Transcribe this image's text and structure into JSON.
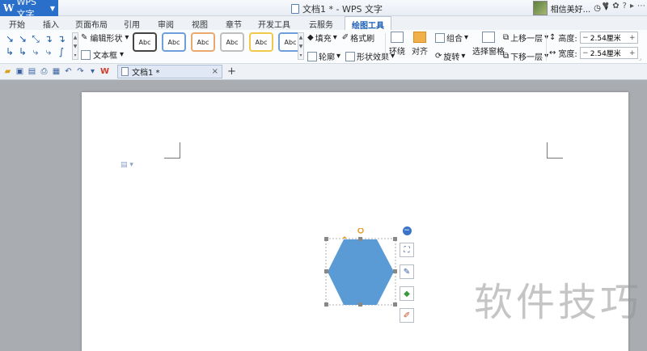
{
  "titlebar": {
    "app_name": "WPS 文字",
    "window_title": "文档1 * - WPS 文字",
    "user_name": "相信美好..."
  },
  "tabs": [
    "开始",
    "插入",
    "页面布局",
    "引用",
    "审阅",
    "视图",
    "章节",
    "开发工具",
    "云服务",
    "绘图工具"
  ],
  "ribbon": {
    "edit_shape": "编辑形状",
    "text_box": "文本框",
    "style_sample": "Abc",
    "style_colors": [
      "#444444",
      "#6f9fd8",
      "#e8a86e",
      "#bfbfbf",
      "#f0c94a",
      "#6f9fd8"
    ],
    "fill": "填充",
    "format_painter": "格式刷",
    "outline": "轮廓",
    "shape_effects": "形状效果",
    "wrap": "环绕",
    "align": "对齐",
    "group": "组合",
    "rotate": "旋转",
    "selection_pane": "选择窗格",
    "bring_forward": "上移一层",
    "send_backward": "下移一层",
    "height_label": "高度:",
    "height_value": "2.54厘米",
    "width_label": "宽度:",
    "width_value": "2.54厘米"
  },
  "doc_tab": {
    "name": "文档1 *"
  },
  "canvas": {
    "shape_color": "#5b9bd5",
    "watermark": "软件技巧"
  }
}
